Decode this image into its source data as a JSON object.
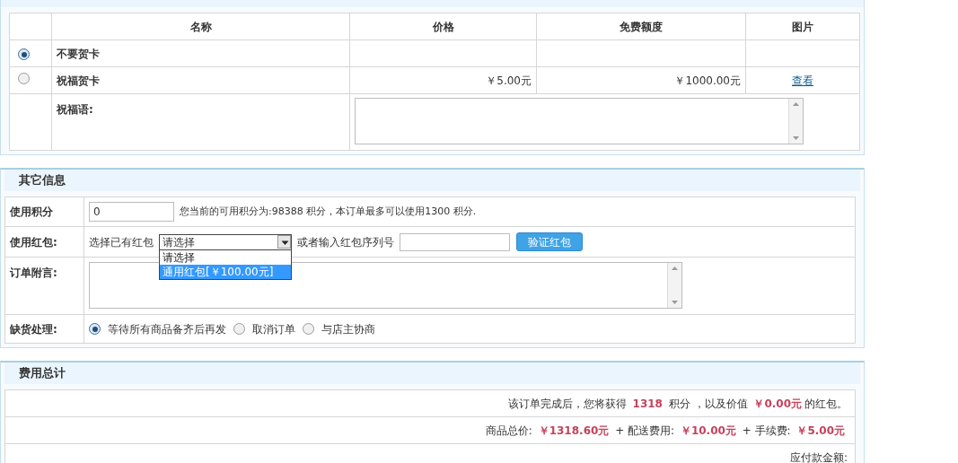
{
  "greeting_cards": {
    "columns": [
      "名称",
      "价格",
      "免费额度",
      "图片"
    ],
    "rows": [
      {
        "selected": true,
        "name": "不要贺卡"
      },
      {
        "selected": false,
        "name": "祝福贺卡",
        "price": "￥5.00元",
        "free_quota": "￥1000.00元",
        "picture_link": "查看"
      }
    ],
    "message": {
      "label": "祝福语:"
    }
  },
  "other_info": {
    "title": "其它信息",
    "points": {
      "label": "使用积分",
      "value": "0",
      "note": "您当前的可用积分为:98388 积分，本订单最多可以使用1300 积分."
    },
    "bonus": {
      "label": "使用红包:",
      "select_label": "选择已有红包",
      "select": {
        "value": "请选择",
        "expanded": true,
        "options": [
          {
            "label": "请选择",
            "highlighted": false
          },
          {
            "label": "通用红包[￥100.00元]",
            "highlighted": true
          }
        ]
      },
      "or_label": "或者输入红包序列号",
      "verify_button": "验证红包"
    },
    "note": {
      "label": "订单附言:"
    },
    "stock": {
      "label": "缺货处理:",
      "options": [
        {
          "label": "等待所有商品备齐后再发",
          "selected": true
        },
        {
          "label": "取消订单",
          "selected": false
        },
        {
          "label": "与店主协商",
          "selected": false
        }
      ]
    }
  },
  "totals": {
    "title": "费用总计",
    "lines": [
      "该订单完成后，您将获得 **1318** 积分 ，以及价值 **￥0.00元**的红包。",
      "商品总价: **￥1318.60元** + 配送费用: **￥10.00元** + 手续费: **￥5.00元**",
      "应付款金额:"
    ]
  }
}
